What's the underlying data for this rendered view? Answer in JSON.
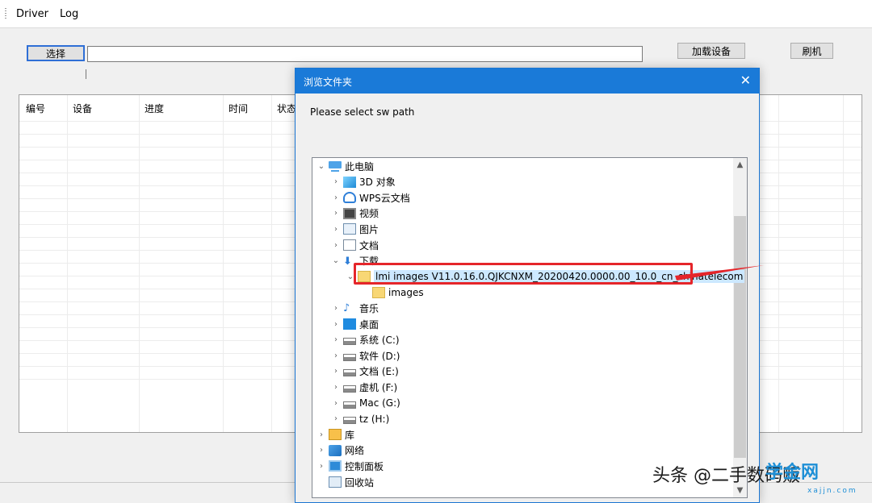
{
  "menu": {
    "driver": "Driver",
    "log": "Log"
  },
  "toolbar": {
    "select_label": "选择",
    "path_value": "",
    "load_device_label": "加载设备",
    "flash_label": "刷机"
  },
  "grid": {
    "columns": [
      "编号",
      "设备",
      "进度",
      "时间",
      "状态"
    ]
  },
  "dialog": {
    "title": "浏览文件夹",
    "close_glyph": "✕",
    "prompt": "Please select sw path",
    "tree": [
      {
        "label": "此电脑",
        "icon": "computer-icon",
        "expanded": true
      },
      {
        "label": "3D 对象",
        "icon": "3d-objects-icon"
      },
      {
        "label": "WPS云文档",
        "icon": "cloud-icon"
      },
      {
        "label": "视频",
        "icon": "video-icon"
      },
      {
        "label": "图片",
        "icon": "picture-icon"
      },
      {
        "label": "文档",
        "icon": "document-icon"
      },
      {
        "label": "下载",
        "icon": "download-icon",
        "expanded": true
      },
      {
        "label": "lmi images V11.0.16.0.QJKCNXM_20200420.0000.00_10.0_cn_chinatelecom",
        "icon": "folder-icon",
        "expanded": true,
        "selected": true
      },
      {
        "label": "images",
        "icon": "folder-icon"
      },
      {
        "label": "音乐",
        "icon": "music-icon"
      },
      {
        "label": "桌面",
        "icon": "desktop-icon"
      },
      {
        "label": "系统 (C:)",
        "icon": "system-drive-icon"
      },
      {
        "label": "软件 (D:)",
        "icon": "drive-icon"
      },
      {
        "label": "文档 (E:)",
        "icon": "drive-icon"
      },
      {
        "label": "虚机 (F:)",
        "icon": "drive-icon"
      },
      {
        "label": "Mac (G:)",
        "icon": "drive-icon"
      },
      {
        "label": "tz (H:)",
        "icon": "drive-icon"
      },
      {
        "label": "库",
        "icon": "library-icon"
      },
      {
        "label": "网络",
        "icon": "network-icon"
      },
      {
        "label": "控制面板",
        "icon": "control-panel-icon"
      },
      {
        "label": "回收站",
        "icon": "recycle-bin-icon"
      }
    ]
  },
  "watermark": {
    "text": "头条 @二手数码贩",
    "logo": "学金网",
    "url": "xajjn.com"
  },
  "colors": {
    "accent": "#1a7ad8",
    "highlight": "#cce8ff",
    "annotation": "#e5252a"
  }
}
